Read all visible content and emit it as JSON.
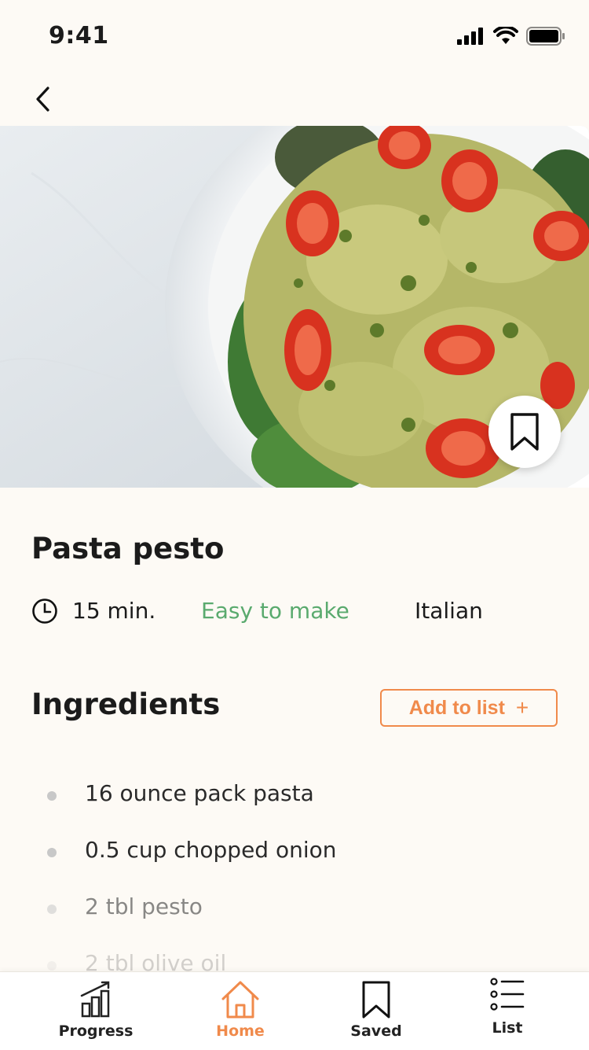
{
  "status_bar": {
    "time": "9:41"
  },
  "recipe": {
    "title": "Pasta pesto",
    "time": "15 min.",
    "difficulty": "Easy to make",
    "cuisine": "Italian"
  },
  "ingredients_section": {
    "title": "Ingredients",
    "add_button_label": "Add to list",
    "add_button_icon": "+",
    "items": [
      "16 ounce pack pasta",
      "0.5 cup chopped onion",
      "2 tbl pesto",
      "2 tbl olive oil"
    ]
  },
  "tab_bar": {
    "tabs": [
      {
        "label": "Progress",
        "icon": "chart-icon"
      },
      {
        "label": "Home",
        "icon": "home-icon",
        "active": true
      },
      {
        "label": "Saved",
        "icon": "bookmark-icon"
      },
      {
        "label": "List",
        "icon": "list-icon"
      }
    ]
  },
  "colors": {
    "accent": "#f08a4b",
    "success": "#5aaa6e",
    "background": "#fdfaf5"
  }
}
